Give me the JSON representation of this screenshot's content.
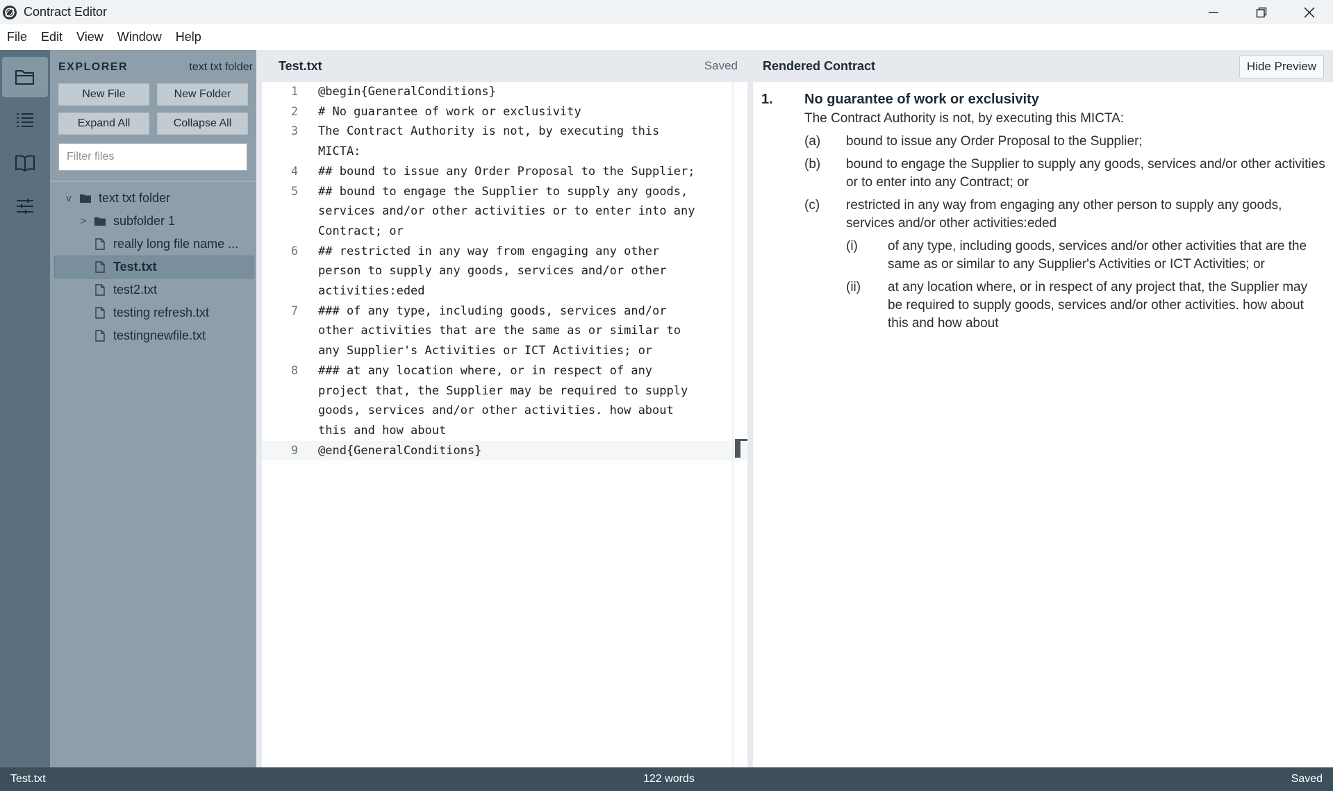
{
  "window": {
    "title": "Contract Editor"
  },
  "menu": [
    "File",
    "Edit",
    "View",
    "Window",
    "Help"
  ],
  "activity_bar": {
    "items": [
      {
        "name": "folder-icon",
        "active": true
      },
      {
        "name": "list-icon",
        "active": false
      },
      {
        "name": "book-icon",
        "active": false
      },
      {
        "name": "sliders-icon",
        "active": false
      }
    ]
  },
  "explorer": {
    "title": "EXPLORER",
    "folder_name": "text txt folder",
    "buttons": {
      "new_file": "New File",
      "new_folder": "New Folder",
      "expand_all": "Expand All",
      "collapse_all": "Collapse All"
    },
    "filter_placeholder": "Filter files",
    "tree": [
      {
        "label": "text txt folder",
        "type": "folder",
        "chevron": "v",
        "depth": 0
      },
      {
        "label": "subfolder 1",
        "type": "folder",
        "chevron": ">",
        "depth": 1
      },
      {
        "label": "really long file name ...",
        "type": "file",
        "depth": 1
      },
      {
        "label": "Test.txt",
        "type": "file",
        "depth": 1,
        "selected": true
      },
      {
        "label": "test2.txt",
        "type": "file",
        "depth": 1
      },
      {
        "label": "testing refresh.txt",
        "type": "file",
        "depth": 1
      },
      {
        "label": "testingnewfile.txt",
        "type": "file",
        "depth": 1
      }
    ]
  },
  "editor": {
    "filename": "Test.txt",
    "status": "Saved",
    "lines": [
      {
        "num": "1",
        "text": "@begin{GeneralConditions}"
      },
      {
        "num": "2",
        "text": "# No guarantee of work or exclusivity"
      },
      {
        "num": "3",
        "text": "The Contract Authority is not, by executing this MICTA:"
      },
      {
        "num": "4",
        "text": "## bound to issue any Order Proposal to the Supplier;"
      },
      {
        "num": "5",
        "text": "## bound to engage the Supplier to supply any goods, services and/or other activities or to enter into any Contract; or"
      },
      {
        "num": "6",
        "text": "## restricted in any way from engaging any other person to supply any goods, services and/or other activities:eded"
      },
      {
        "num": "7",
        "text": "### of any type, including goods, services and/or other activities that are the same as or similar to any Supplier's Activities or ICT Activities; or"
      },
      {
        "num": "8",
        "text": "### at any location where, or in respect of any project that, the Supplier may be required to supply goods, services and/or other activities. how about this and how about"
      },
      {
        "num": "9",
        "text": "@end{GeneralConditions}"
      }
    ]
  },
  "preview": {
    "title": "Rendered Contract",
    "hide_button": "Hide Preview",
    "heading_num": "1.",
    "heading": "No guarantee of work or exclusivity",
    "intro": "The Contract Authority is not, by executing this MICTA:",
    "items": [
      {
        "mark": "(a)",
        "text": "bound to issue any Order Proposal to the Supplier;"
      },
      {
        "mark": "(b)",
        "text": "bound to engage the Supplier to supply any goods, services and/or other activities or to enter into any Contract; or"
      },
      {
        "mark": "(c)",
        "text": "restricted in any way from engaging any other person to supply any goods, services and/or other activities:eded"
      }
    ],
    "subitems": [
      {
        "mark": "(i)",
        "text": "of any type, including goods, services and/or other activities that are the same as or similar to any Supplier's Activities or ICT Activities; or"
      },
      {
        "mark": "(ii)",
        "text": "at any location where, or in respect of any project that, the Supplier may be required to supply goods, services and/or other activities. how about this and how about"
      }
    ]
  },
  "statusbar": {
    "file": "Test.txt",
    "words": "122 words",
    "status": "Saved"
  }
}
